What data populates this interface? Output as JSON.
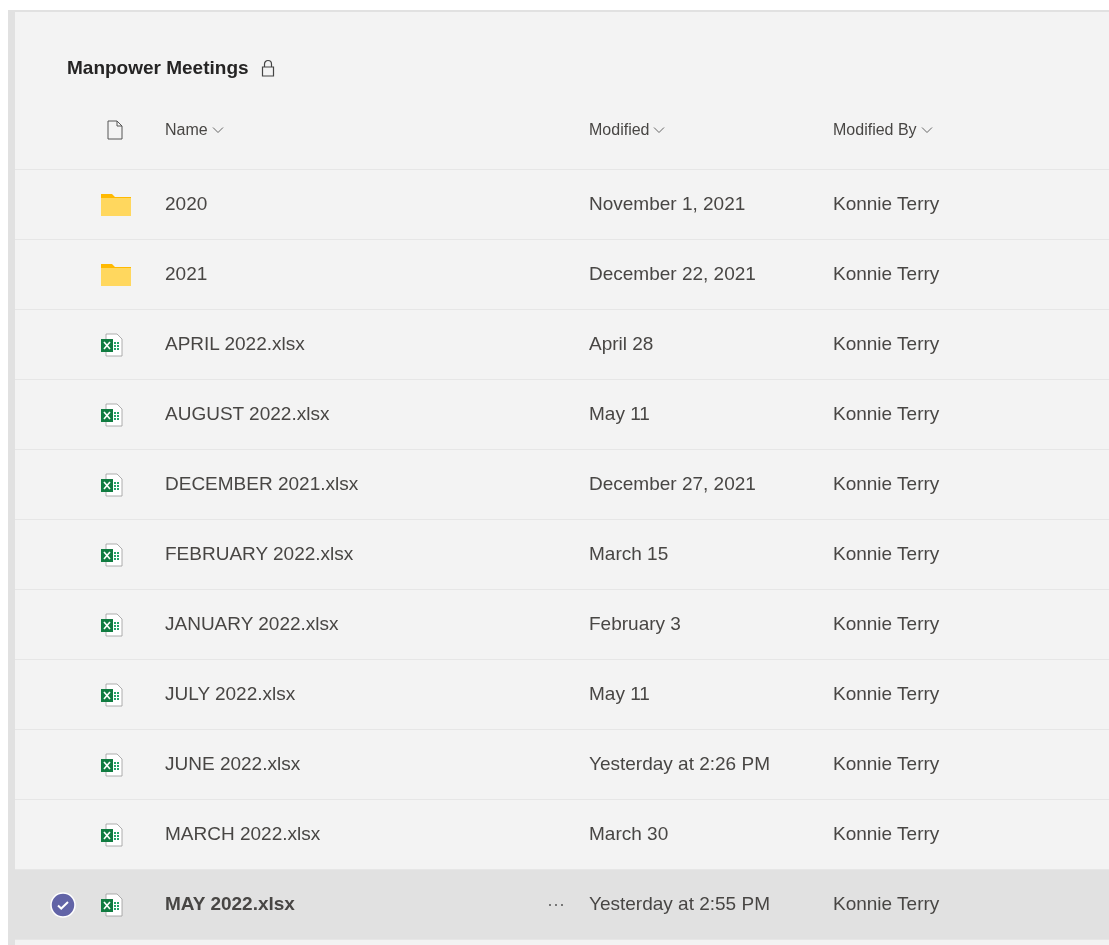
{
  "library": {
    "title": "Manpower Meetings",
    "locked": true
  },
  "columns": [
    {
      "kind": "type"
    },
    {
      "kind": "text",
      "label": "Name"
    },
    {
      "kind": "text",
      "label": "Modified"
    },
    {
      "kind": "text",
      "label": "Modified By"
    }
  ],
  "rows": [
    {
      "kind": "folder",
      "name": "2020",
      "modified": "November 1, 2021",
      "modified_by": "Konnie Terry",
      "selected": false
    },
    {
      "kind": "folder",
      "name": "2021",
      "modified": "December 22, 2021",
      "modified_by": "Konnie Terry",
      "selected": false
    },
    {
      "kind": "excel",
      "name": "APRIL 2022.xlsx",
      "modified": "April 28",
      "modified_by": "Konnie Terry",
      "selected": false
    },
    {
      "kind": "excel",
      "name": "AUGUST 2022.xlsx",
      "modified": "May 11",
      "modified_by": "Konnie Terry",
      "selected": false
    },
    {
      "kind": "excel",
      "name": "DECEMBER 2021.xlsx",
      "modified": "December 27, 2021",
      "modified_by": "Konnie Terry",
      "selected": false
    },
    {
      "kind": "excel",
      "name": "FEBRUARY 2022.xlsx",
      "modified": "March 15",
      "modified_by": "Konnie Terry",
      "selected": false
    },
    {
      "kind": "excel",
      "name": "JANUARY 2022.xlsx",
      "modified": "February 3",
      "modified_by": "Konnie Terry",
      "selected": false
    },
    {
      "kind": "excel",
      "name": "JULY 2022.xlsx",
      "modified": "May 11",
      "modified_by": "Konnie Terry",
      "selected": false
    },
    {
      "kind": "excel",
      "name": "JUNE 2022.xlsx",
      "modified": "Yesterday at 2:26 PM",
      "modified_by": "Konnie Terry",
      "selected": false
    },
    {
      "kind": "excel",
      "name": "MARCH 2022.xlsx",
      "modified": "March 30",
      "modified_by": "Konnie Terry",
      "selected": false
    },
    {
      "kind": "excel",
      "name": "MAY 2022.xlsx",
      "more": "···",
      "modified": "Yesterday at 2:55 PM",
      "modified_by": "Konnie Terry",
      "selected": true
    }
  ]
}
